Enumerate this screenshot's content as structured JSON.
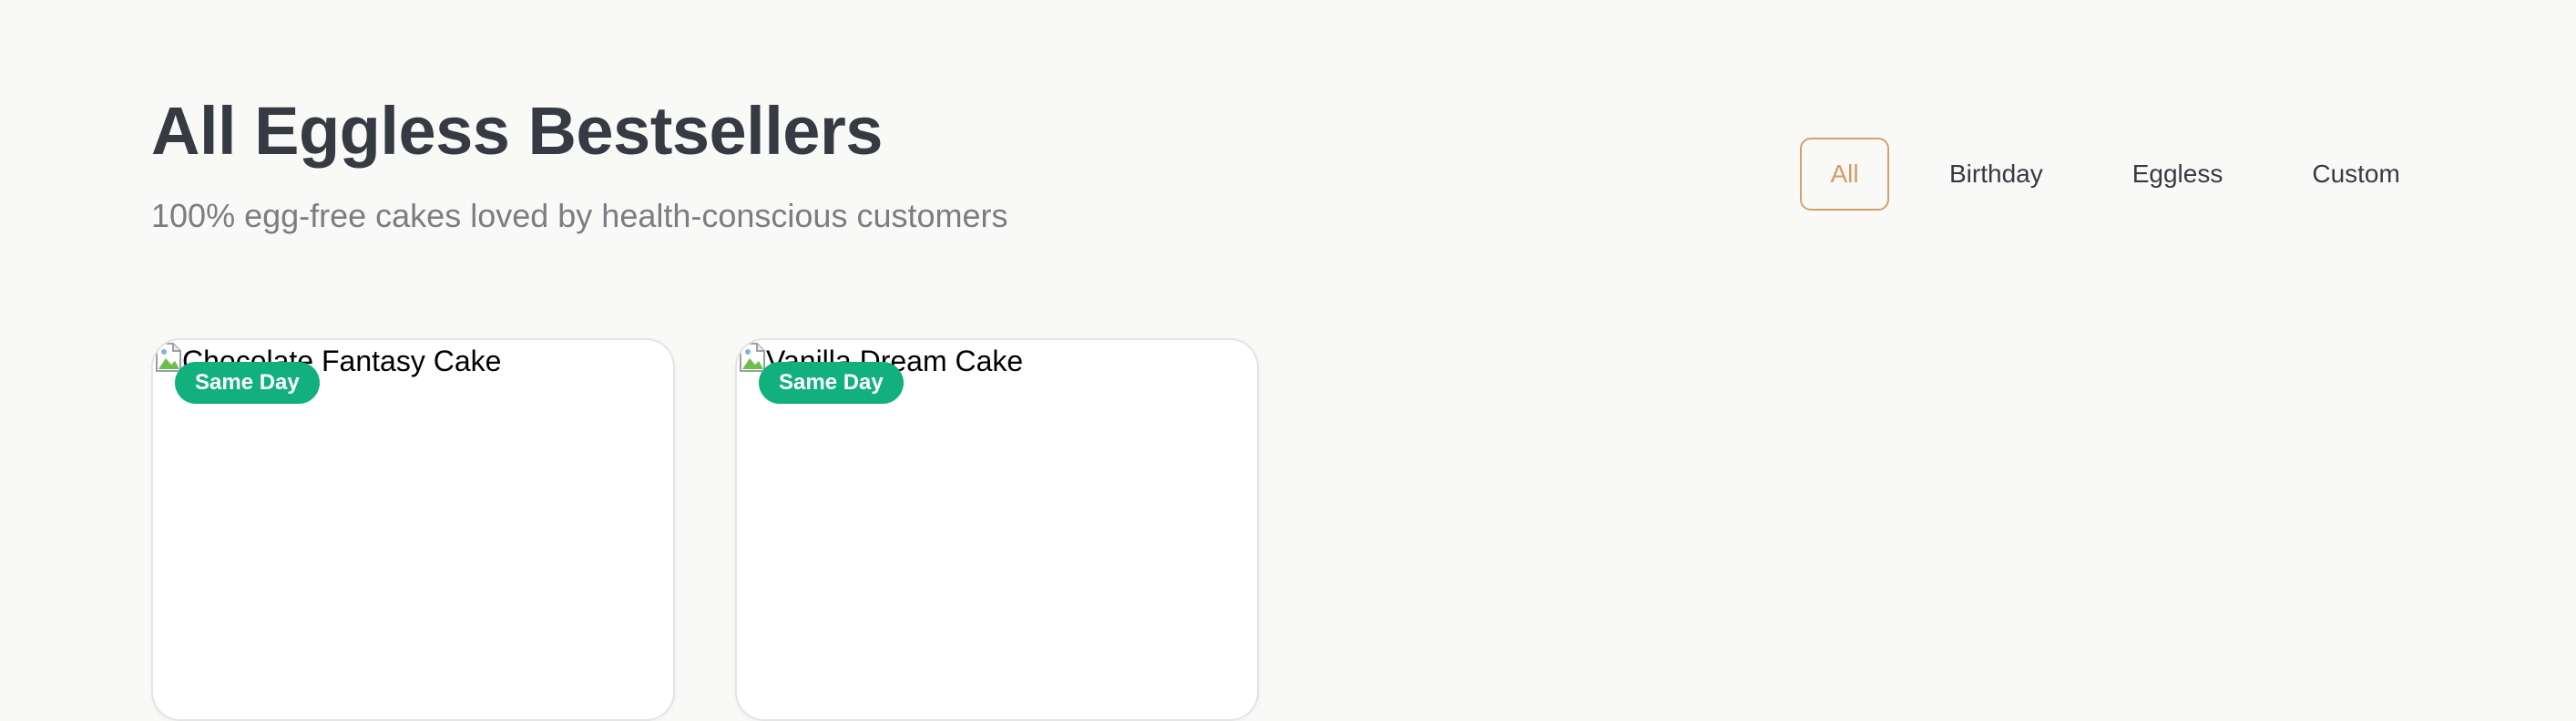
{
  "section": {
    "title": "All Eggless Bestsellers",
    "subtitle": "100% egg-free cakes loved by health-conscious customers"
  },
  "filters": {
    "active": "All",
    "items": [
      {
        "label": "All",
        "active": true
      },
      {
        "label": "Birthday",
        "active": false
      },
      {
        "label": "Eggless",
        "active": false
      },
      {
        "label": "Custom",
        "active": false
      }
    ]
  },
  "products": [
    {
      "image_alt": "Chocolate Fantasy Cake",
      "badge": "Same Day",
      "icon": "broken-image-icon"
    },
    {
      "image_alt": "Vanilla Dream Cake",
      "badge": "Same Day",
      "icon": "broken-image-icon"
    }
  ],
  "colors": {
    "background": "#f9f9f7",
    "title": "#363a42",
    "subtitle": "#7a7d82",
    "accent": "#d49a66",
    "badge": "#12b07d"
  }
}
